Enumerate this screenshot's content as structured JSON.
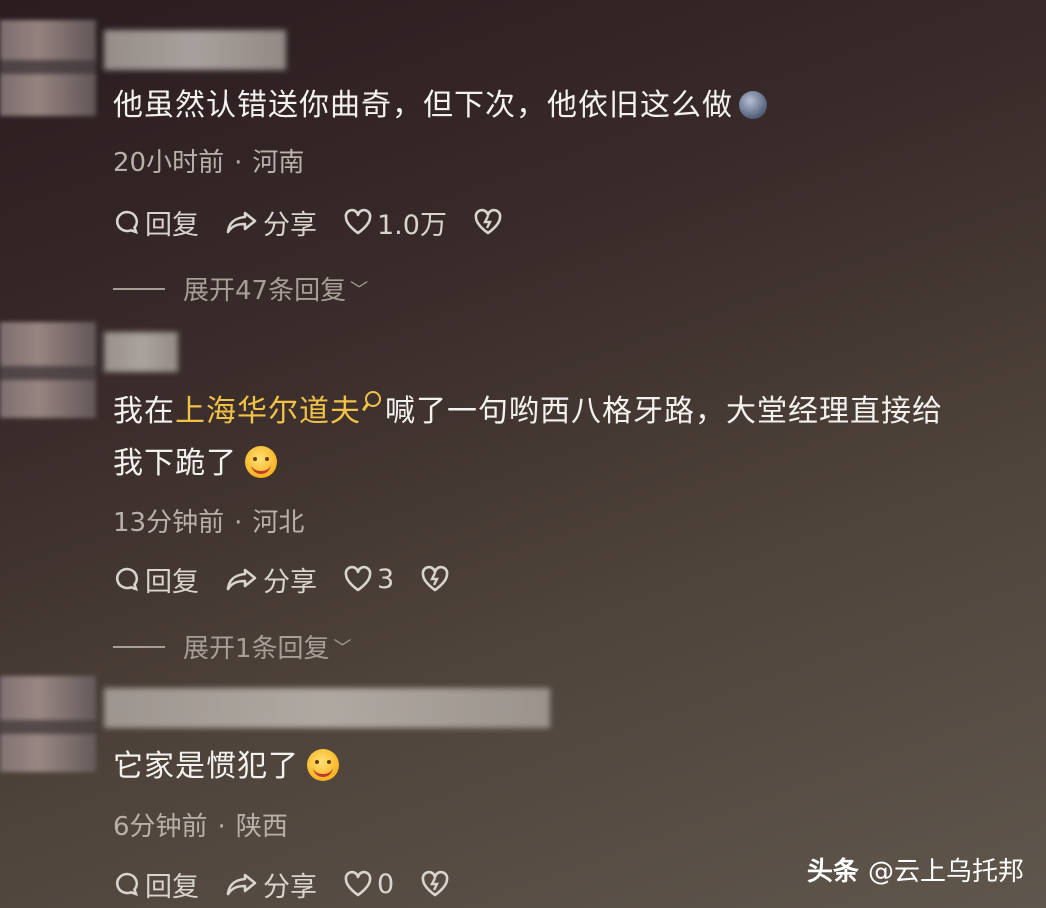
{
  "comments": [
    {
      "text": "他虽然认错送你曲奇，但下次，他依旧这么做",
      "time": "20小时前",
      "location": "河南",
      "reply_label": "回复",
      "share_label": "分享",
      "like_count": "1.0万",
      "expand_label": "展开47条回复"
    },
    {
      "text_before": "我在",
      "text_highlight": "上海华尔道夫",
      "text_after": "喊了一句哟西八格牙路，大堂经理直接给",
      "text_line2": "我下跪了",
      "time": "13分钟前",
      "location": "河北",
      "reply_label": "回复",
      "share_label": "分享",
      "like_count": "3",
      "expand_label": "展开1条回复"
    },
    {
      "text": "它家是惯犯了",
      "time": "6分钟前",
      "location": "陕西",
      "reply_label": "回复",
      "share_label": "分享",
      "like_count": "0"
    }
  ],
  "meta_separator": "·",
  "watermark": {
    "brand": "头条",
    "handle": "@云上乌托邦"
  },
  "colors": {
    "highlight": "#f1c248",
    "text": "#f4f2ee",
    "meta": "#b9b1a9"
  }
}
